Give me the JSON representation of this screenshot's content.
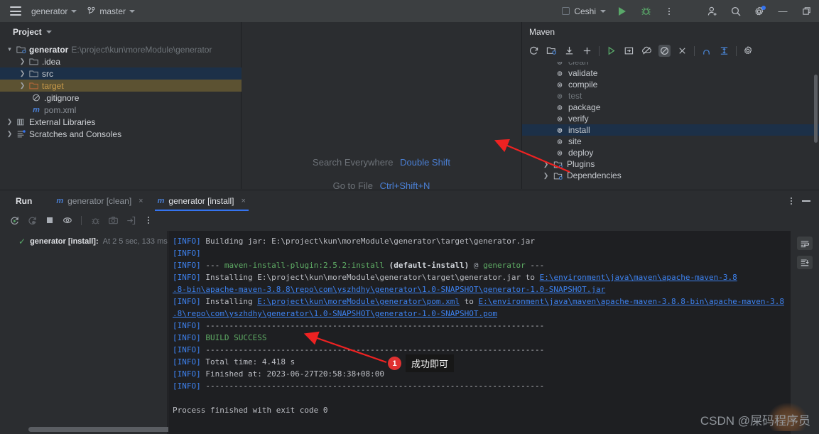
{
  "titlebar": {
    "menu_icon": "hamburger-icon",
    "project_name": "generator",
    "branch_icon": "git-branch-icon",
    "branch_name": "master",
    "run_config": "Ceshi",
    "run_icon": "run-icon",
    "debug_icon": "debug-icon",
    "more_icon": "more-vertical-icon",
    "account_icon": "add-account-icon",
    "search_icon": "search-icon",
    "settings_icon": "gear-icon",
    "minimize_label": "—",
    "restore_label": "❐"
  },
  "project": {
    "header_title": "Project",
    "tree": [
      {
        "label": "generator",
        "path": "E:\\project\\kun\\moreModule\\generator",
        "icon": "module-icon",
        "arrow": "expanded",
        "state": "root"
      },
      {
        "label": ".idea",
        "icon": "folder-icon",
        "arrow": "collapsed",
        "state": "normal"
      },
      {
        "label": "src",
        "icon": "folder-icon",
        "arrow": "collapsed",
        "state": "selected"
      },
      {
        "label": "target",
        "icon": "folder-excluded-icon",
        "arrow": "collapsed",
        "state": "target"
      },
      {
        "label": ".gitignore",
        "icon": "gitignore-icon",
        "arrow": "none",
        "state": "file"
      },
      {
        "label": "pom.xml",
        "icon": "maven-pom-icon",
        "arrow": "none",
        "state": "dimfile"
      },
      {
        "label": "External Libraries",
        "icon": "library-icon",
        "arrow": "collapsed",
        "state": "normal"
      },
      {
        "label": "Scratches and Consoles",
        "icon": "scratches-icon",
        "arrow": "collapsed",
        "state": "normal"
      }
    ]
  },
  "editor": {
    "tips": [
      {
        "action": "Search Everywhere",
        "shortcut": "Double Shift"
      },
      {
        "action": "Go to File",
        "shortcut": "Ctrl+Shift+N"
      }
    ]
  },
  "maven": {
    "header_title": "Maven",
    "toolbar_icons": [
      "reload-all-maven-projects-icon",
      "generate-sources-icon",
      "download-sources-icon",
      "add-maven-project-icon",
      "run-maven-build-icon",
      "execute-maven-goal-icon",
      "toggle-offline-mode-icon",
      "skip-tests-icon",
      "collapse-all-icon",
      "show-dependencies-icon",
      "expand-icon",
      "maven-settings-icon"
    ],
    "tree": [
      {
        "label": "clean",
        "icon": "maven-goal-icon",
        "state": "cut-off"
      },
      {
        "label": "validate",
        "icon": "maven-goal-icon",
        "state": "normal"
      },
      {
        "label": "compile",
        "icon": "maven-goal-icon",
        "state": "normal"
      },
      {
        "label": "test",
        "icon": "maven-goal-icon",
        "state": "dim"
      },
      {
        "label": "package",
        "icon": "maven-goal-icon",
        "state": "normal"
      },
      {
        "label": "verify",
        "icon": "maven-goal-icon",
        "state": "normal"
      },
      {
        "label": "install",
        "icon": "maven-goal-icon",
        "state": "selected"
      },
      {
        "label": "site",
        "icon": "maven-goal-icon",
        "state": "normal"
      },
      {
        "label": "deploy",
        "icon": "maven-goal-icon",
        "state": "normal"
      },
      {
        "label": "Plugins",
        "icon": "plugins-node-icon",
        "state": "node"
      },
      {
        "label": "Dependencies",
        "icon": "dependencies-node-icon",
        "state": "node"
      }
    ]
  },
  "run": {
    "title": "Run",
    "tabs": [
      {
        "label": "generator [clean]",
        "icon": "maven-m-icon",
        "active": false,
        "close": "×"
      },
      {
        "label": "generator [install]",
        "icon": "maven-m-icon",
        "active": true,
        "close": "×"
      }
    ],
    "toolbar_icons": [
      "rerun-icon",
      "rerun-failed-icon",
      "stop-icon",
      "filter-icon",
      "debug-icon",
      "screenshot-icon",
      "export-icon",
      "more-vertical-icon"
    ],
    "tab_actions": [
      "more-vertical-icon",
      "hide-icon"
    ],
    "result": {
      "status_icon": "success-check-icon",
      "name": "generator [install]:",
      "time": "At 2 5 sec, 133 ms"
    },
    "console_side_icons": [
      "soft-wrap-icon",
      "scroll-to-end-icon"
    ],
    "console_lines": [
      {
        "segments": [
          {
            "t": "[INFO]",
            "c": "info"
          },
          {
            "t": " Building jar: E:\\project\\kun\\moreModule\\generator\\target\\generator.jar",
            "c": "plain"
          }
        ]
      },
      {
        "segments": [
          {
            "t": "[INFO]",
            "c": "info"
          }
        ]
      },
      {
        "segments": [
          {
            "t": "[INFO]",
            "c": "info"
          },
          {
            "t": " --- ",
            "c": "plain"
          },
          {
            "t": "maven-install-plugin:2.5.2:install",
            "c": "grn"
          },
          {
            "t": " (default-install)",
            "c": "bold"
          },
          {
            "t": " @ ",
            "c": "at"
          },
          {
            "t": "generator",
            "c": "grn"
          },
          {
            "t": " ---",
            "c": "plain"
          }
        ]
      },
      {
        "segments": [
          {
            "t": "[INFO]",
            "c": "info"
          },
          {
            "t": " Installing E:\\project\\kun\\moreModule\\generator\\target\\generator.jar to ",
            "c": "plain"
          },
          {
            "t": "E:\\environment\\java\\maven\\apache-maven-3.8",
            "c": "lnk"
          }
        ]
      },
      {
        "segments": [
          {
            "t": " ",
            "c": "plain"
          },
          {
            "t": ".8-bin\\apache-maven-3.8.8\\repo\\com\\yszhdhy\\generator\\1.0-SNAPSHOT\\generator-1.0-SNAPSHOT.jar",
            "c": "lnk"
          }
        ]
      },
      {
        "segments": [
          {
            "t": "[INFO]",
            "c": "info"
          },
          {
            "t": " Installing ",
            "c": "plain"
          },
          {
            "t": "E:\\project\\kun\\moreModule\\generator\\pom.xml",
            "c": "lnk"
          },
          {
            "t": " to ",
            "c": "plain"
          },
          {
            "t": "E:\\environment\\java\\maven\\apache-maven-3.8.8-bin\\apache-maven-3.8",
            "c": "lnk"
          }
        ]
      },
      {
        "segments": [
          {
            "t": " ",
            "c": "plain"
          },
          {
            "t": ".8\\repo\\com\\yszhdhy\\generator\\1.0-SNAPSHOT\\generator-1.0-SNAPSHOT.pom",
            "c": "lnk"
          }
        ]
      },
      {
        "segments": [
          {
            "t": "[INFO]",
            "c": "info"
          },
          {
            "t": " ------------------------------------------------------------------------",
            "c": "plain"
          }
        ]
      },
      {
        "segments": [
          {
            "t": "[INFO]",
            "c": "info"
          },
          {
            "t": " ",
            "c": "plain"
          },
          {
            "t": "BUILD SUCCESS",
            "c": "grn"
          }
        ]
      },
      {
        "segments": [
          {
            "t": "[INFO]",
            "c": "info"
          },
          {
            "t": " ------------------------------------------------------------------------",
            "c": "plain"
          }
        ]
      },
      {
        "segments": [
          {
            "t": "[INFO]",
            "c": "info"
          },
          {
            "t": " Total time:  4.418 s",
            "c": "plain"
          }
        ]
      },
      {
        "segments": [
          {
            "t": "[INFO]",
            "c": "info"
          },
          {
            "t": " Finished at: 2023-06-27T20:58:38+08:00",
            "c": "plain"
          }
        ]
      },
      {
        "segments": [
          {
            "t": "[INFO]",
            "c": "info"
          },
          {
            "t": " ------------------------------------------------------------------------",
            "c": "plain"
          }
        ]
      },
      {
        "segments": []
      },
      {
        "segments": [
          {
            "t": "Process finished with exit code 0",
            "c": "plain"
          }
        ]
      }
    ]
  },
  "annotations": {
    "callout_number": "1",
    "callout_text": "成功即可",
    "arrow_color": "#ee2222"
  },
  "watermark": {
    "text": "CSDN @屎码程序员"
  },
  "colors": {
    "background": "#2b2d30",
    "console_background": "#1e1f22",
    "titlebar": "#3c3f41",
    "selection": "#1c3048",
    "target_row": "#5c5232",
    "accent_blue": "#3574f0",
    "success_green": "#59a869",
    "link_blue": "#3d82f0",
    "annotation_red": "#e03131"
  }
}
